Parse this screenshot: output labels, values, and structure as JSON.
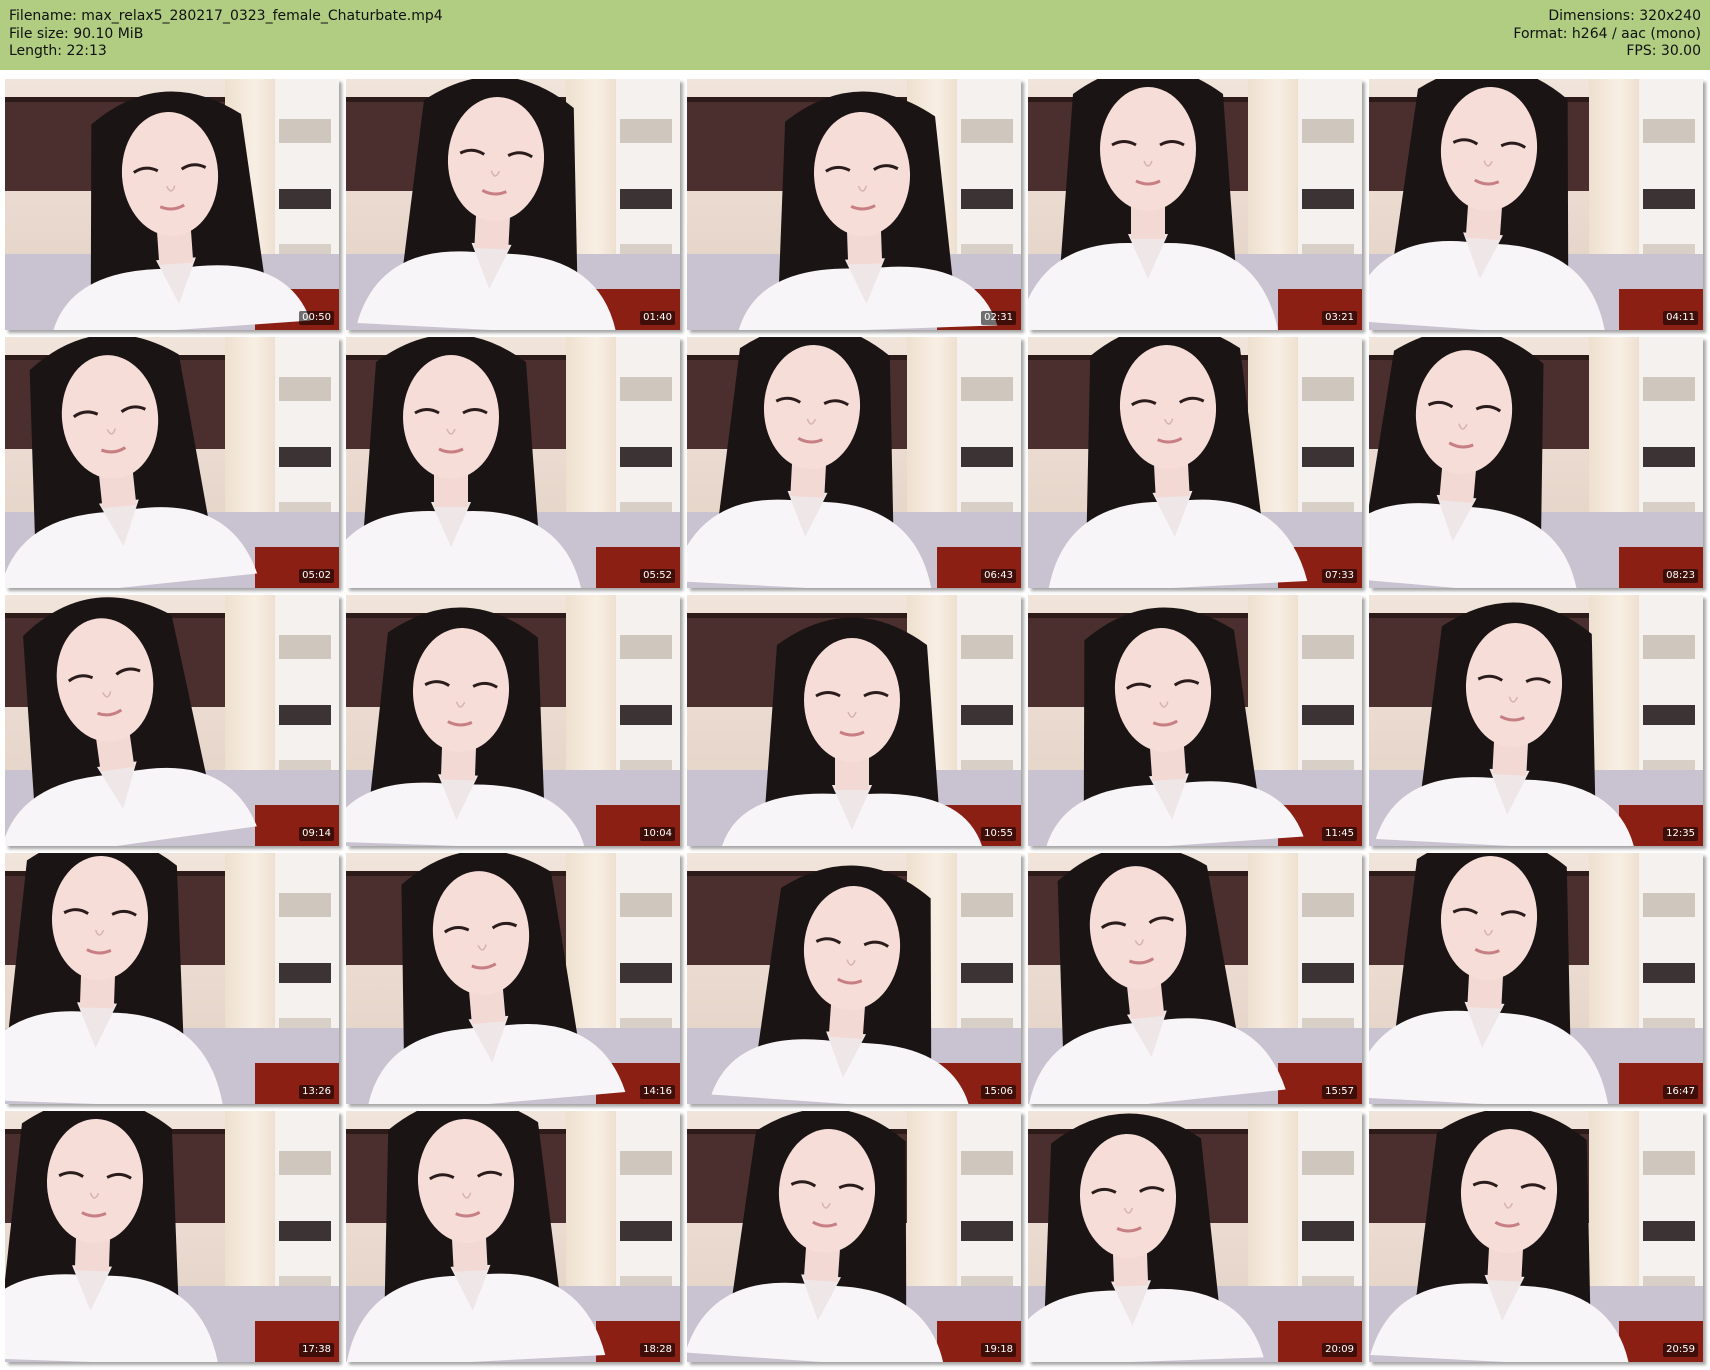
{
  "header": {
    "filename": "Filename: max_relax5_280217_0323_female_Chaturbate.mp4",
    "filesize": "File size: 90.10 MiB",
    "length": "Length: 22:13",
    "dimensions": "Dimensions: 320x240",
    "format": "Format: h264 / aac (mono)",
    "fps": "FPS: 30.00"
  },
  "colors": {
    "header_bg": "#b0cd82",
    "timestamp_bg": "#000000",
    "timestamp_text": "#ffffff"
  },
  "thumbnails": [
    {
      "timestamp": "00:50"
    },
    {
      "timestamp": "01:40"
    },
    {
      "timestamp": "02:31"
    },
    {
      "timestamp": "03:21"
    },
    {
      "timestamp": "04:11"
    },
    {
      "timestamp": "05:02"
    },
    {
      "timestamp": "05:52"
    },
    {
      "timestamp": "06:43"
    },
    {
      "timestamp": "07:33"
    },
    {
      "timestamp": "08:23"
    },
    {
      "timestamp": "09:14"
    },
    {
      "timestamp": "10:04"
    },
    {
      "timestamp": "10:55"
    },
    {
      "timestamp": "11:45"
    },
    {
      "timestamp": "12:35"
    },
    {
      "timestamp": "13:26"
    },
    {
      "timestamp": "14:16"
    },
    {
      "timestamp": "15:06"
    },
    {
      "timestamp": "15:57"
    },
    {
      "timestamp": "16:47"
    },
    {
      "timestamp": "17:38"
    },
    {
      "timestamp": "18:28"
    },
    {
      "timestamp": "19:18"
    },
    {
      "timestamp": "20:09"
    },
    {
      "timestamp": "20:59"
    }
  ]
}
